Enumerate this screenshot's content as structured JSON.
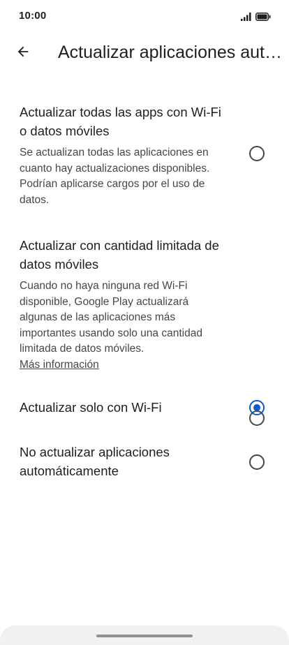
{
  "status_bar": {
    "time": "10:00",
    "icons": [
      "signal-icon",
      "battery-icon"
    ]
  },
  "app_bar": {
    "back_icon": "arrow-back-icon",
    "title": "Actualizar aplicaciones automáticamente"
  },
  "options": [
    {
      "title": "Actualizar todas las apps con Wi-Fi o datos móviles",
      "description": "Se actualizan todas las aplicaciones en cuanto hay actualizaciones disponibles. Podrían aplicarse cargos por el uso de datos.",
      "selected": false
    },
    {
      "title": "Actualizar con cantidad limitada de datos móviles",
      "description": "Cuando no haya ninguna red Wi-Fi disponible, Google Play actualizará algunas de las aplicaciones más importantes usando solo una cantidad limitada de datos móviles.",
      "link": "Más información",
      "selected": false
    },
    {
      "title": "Actualizar solo con Wi-Fi",
      "selected": true
    },
    {
      "title": "No actualizar aplicaciones automáticamente",
      "selected": false
    }
  ],
  "colors": {
    "accent": "#0b57d0",
    "text": "#1f1f1f",
    "secondary_text": "#444746"
  }
}
